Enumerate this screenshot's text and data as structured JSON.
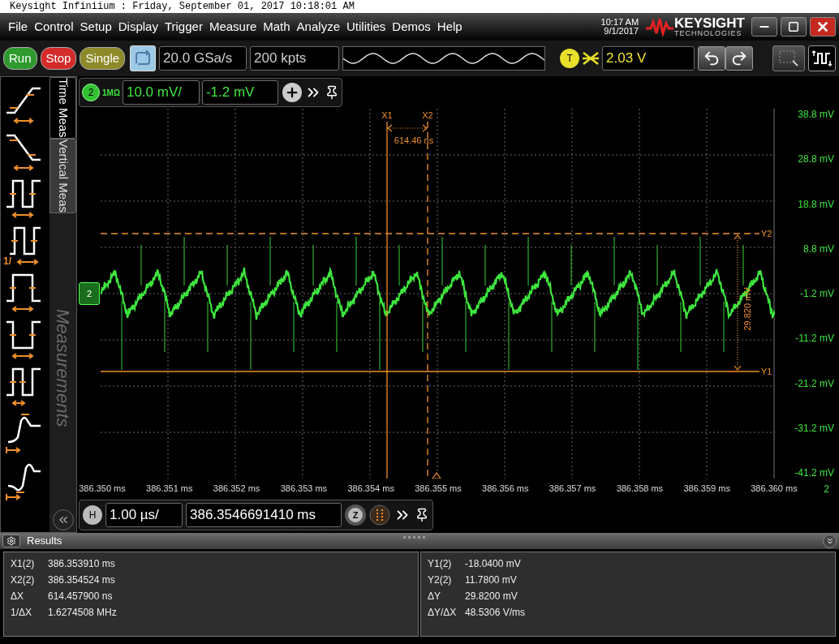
{
  "window": {
    "title": "Keysight Infiniium : Friday, September 01, 2017 10:18:01 AM"
  },
  "menu": {
    "items": [
      "File",
      "Control",
      "Setup",
      "Display",
      "Trigger",
      "Measure",
      "Math",
      "Analyze",
      "Utilities",
      "Demos",
      "Help"
    ],
    "time": "10:17 AM",
    "date": "9/1/2017",
    "logo": {
      "name": "KEYSIGHT",
      "sub": "TECHNOLOGIES"
    }
  },
  "toolbar": {
    "run_buttons": [
      {
        "label": "Run",
        "color": "#2e9a2e"
      },
      {
        "label": "Stop",
        "color": "#d42a2a"
      },
      {
        "label": "Single",
        "color": "#8e8a2a"
      }
    ],
    "sample_rate": "20.0 GSa/s",
    "memory_depth": "200 kpts",
    "trigger_badge": "T",
    "trigger_level": "2.03 V"
  },
  "channel": {
    "number": "2",
    "impedance": "1MΩ",
    "scale": "10.0 mV/",
    "offset": "-1.2 mV"
  },
  "measure_panel": {
    "tabs": [
      {
        "label": "Time Meas",
        "selected": true
      },
      {
        "label": "Vertical Meas",
        "selected": false
      }
    ],
    "watermark": "Measurements",
    "items": [
      {
        "kind": "rise"
      },
      {
        "kind": "fall"
      },
      {
        "kind": "period"
      },
      {
        "kind": "frequency",
        "label": "1/"
      },
      {
        "kind": "positive-width"
      },
      {
        "kind": "negative-width"
      },
      {
        "kind": "duty"
      },
      {
        "kind": "overshoot"
      },
      {
        "kind": "preshoot"
      }
    ]
  },
  "plot": {
    "y_labels": [
      "38.8 mV",
      "28.8 mV",
      "18.8 mV",
      "8.8 mV",
      "-1.2 mV",
      "-11.2 mV",
      "-21.2 mV",
      "-31.2 mV",
      "-41.2 mV"
    ],
    "x_labels": [
      "386.350 ms",
      "386.351 ms",
      "386.352 ms",
      "386.353 ms",
      "386.354 ms",
      "386.355 ms",
      "386.356 ms",
      "386.357 ms",
      "386.358 ms",
      "386.359 ms",
      "386.360 ms"
    ],
    "channel_marker": "2",
    "channel_label": "2",
    "cursors": {
      "x1": "X1",
      "x2": "X2",
      "dx": "614.46 ns",
      "y1": "Y1",
      "y2": "Y2",
      "dy": "29.820 mV"
    }
  },
  "horizontal": {
    "badge": "H",
    "scale": "1.00 µs/",
    "position": "386.3546691410 ms",
    "zoom_badge": "Z"
  },
  "results": {
    "title": "Results",
    "columns": [
      [
        {
          "label": "X1(2)",
          "value": "386.353910 ms"
        },
        {
          "label": "X2(2)",
          "value": "386.354524 ms"
        },
        {
          "label": "ΔX",
          "value": "614.457900 ns"
        },
        {
          "label": "1/ΔX",
          "value": "1.6274508 MHz"
        }
      ],
      [
        {
          "label": "Y1(2)",
          "value": "-18.0400 mV"
        },
        {
          "label": "Y2(2)",
          "value": "11.7800 mV"
        },
        {
          "label": "ΔY",
          "value": "29.8200 mV"
        },
        {
          "label": "ΔY/ΔX",
          "value": "48.5306 V/ms"
        }
      ]
    ]
  }
}
